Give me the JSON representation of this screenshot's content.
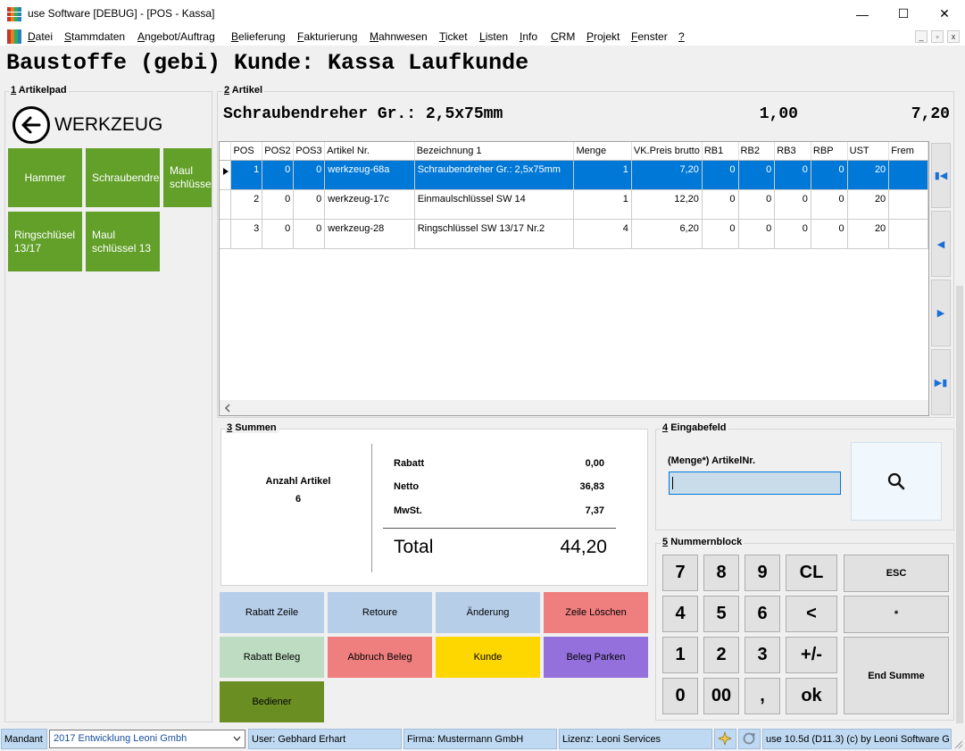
{
  "window": {
    "title": "use Software [DEBUG] - [POS - Kassa]",
    "minimize": "—",
    "maximize": "☐",
    "close": "✕"
  },
  "menu": {
    "items": [
      "Datei",
      "Stammdaten",
      "Angebot/Auftrag",
      "Belieferung",
      "Fakturierung",
      "Mahnwesen",
      "Ticket",
      "Listen",
      "Info",
      "CRM",
      "Projekt",
      "Fenster",
      "?"
    ],
    "mdi_min": "_",
    "mdi_restore": "▫",
    "mdi_close": "x"
  },
  "header": {
    "title": "Baustoffe (gebi) Kunde: Kassa Laufkunde"
  },
  "artikelpad": {
    "group_num": "1",
    "group_label": "Artikelpad",
    "category": "WERKZEUG",
    "tiles": [
      "Hammer",
      "Schraubendreher",
      "Maul schlüssel",
      "Ringschlüsel 13/17",
      "Maul schlüssel 13"
    ]
  },
  "artikel": {
    "group_num": "2",
    "group_label": "Artikel",
    "current_name": "Schraubendreher Gr.: 2,5x75mm",
    "current_qty": "1,00",
    "current_price": "7,20",
    "columns": [
      "POS",
      "POS2",
      "POS3",
      "Artikel Nr.",
      "Bezeichnung 1",
      "Menge",
      "VK.Preis brutto",
      "RB1",
      "RB2",
      "RB3",
      "RBP",
      "UST",
      "Frem"
    ],
    "rows": [
      [
        "1",
        "0",
        "0",
        "werkzeug-68a",
        "Schraubendreher Gr.: 2,5x75mm",
        "1",
        "7,20",
        "0",
        "0",
        "0",
        "0",
        "20",
        ""
      ],
      [
        "2",
        "0",
        "0",
        "werkzeug-17c",
        "Einmaulschlüssel  SW 14",
        "1",
        "12,20",
        "0",
        "0",
        "0",
        "0",
        "20",
        ""
      ],
      [
        "3",
        "0",
        "0",
        "werkzeug-28",
        "Ringschlüssel  SW 13/17 Nr.2",
        "4",
        "6,20",
        "0",
        "0",
        "0",
        "0",
        "20",
        ""
      ]
    ],
    "selected_row": 0
  },
  "summen": {
    "group_num": "3",
    "group_label": "Summen",
    "anzahl_label": "Anzahl Artikel",
    "anzahl_value": "6",
    "rabatt_label": "Rabatt",
    "rabatt_value": "0,00",
    "netto_label": "Netto",
    "netto_value": "36,83",
    "mwst_label": "MwSt.",
    "mwst_value": "7,37",
    "total_label": "Total",
    "total_value": "44,20"
  },
  "buttons": {
    "rabatt_zeile": "Rabatt Zeile",
    "retoure": "Retoure",
    "aenderung": "Änderung",
    "zeile_loeschen": "Zeile Löschen",
    "rabatt_beleg": "Rabatt Beleg",
    "abbruch_beleg": "Abbruch Beleg",
    "kunde": "Kunde",
    "beleg_parken": "Beleg Parken",
    "bediener": "Bediener"
  },
  "eingabe": {
    "group_num": "4",
    "group_label": "Eingabefeld",
    "field_label": "(Menge*)  ArtikelNr.",
    "value": ""
  },
  "nummernblock": {
    "group_num": "5",
    "group_label": "Nummernblock",
    "keys": [
      "7",
      "8",
      "9",
      "CL",
      "4",
      "5",
      "6",
      "<",
      "1",
      "2",
      "3",
      "+/-",
      "0",
      "00",
      ",",
      "ok"
    ],
    "esc": "ESC",
    "star": "*",
    "end_summe": "End Summe"
  },
  "status": {
    "mandant_label": "Mandant",
    "mandant_value": "2017  Entwicklung Leoni Gmbh",
    "user": "User: Gebhard Erhart",
    "firma": "Firma: Mustermann GmbH",
    "lizenz": "Lizenz: Leoni Services",
    "version": "use 10.5d (D11.3) (c) by Leoni Software G"
  },
  "colors": {
    "tile_green": "#62a029",
    "selection_blue": "#0078d7",
    "btn_blue": "#b7cee9",
    "btn_red": "#ef7f7f",
    "btn_green_light": "#bddcc2",
    "btn_yellow": "#ffd700",
    "btn_purple": "#9370db",
    "btn_olive": "#6b8e23"
  }
}
